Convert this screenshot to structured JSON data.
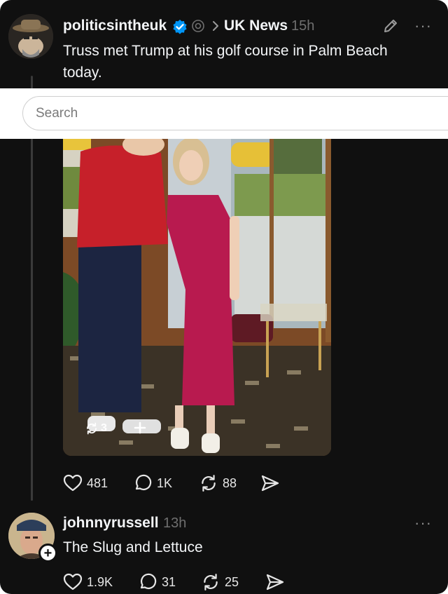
{
  "post": {
    "username": "politicsintheuk",
    "community": "UK News",
    "time": "15h",
    "text_line1": "Truss met Trump at his golf course in Palm Beach",
    "text_line2": "today.",
    "more": "···",
    "image_repost_count": "3",
    "actions": {
      "likes": "481",
      "replies": "1K",
      "reposts": "88"
    }
  },
  "search": {
    "placeholder": "Search"
  },
  "reply": {
    "username": "johnnyrussell",
    "time": "13h",
    "text": "The Slug and Lettuce",
    "follow": "+",
    "more": "···",
    "actions": {
      "likes": "1.9K",
      "replies": "31",
      "reposts": "25"
    }
  },
  "colors": {
    "background": "#101010",
    "verified": "#0095f6",
    "muted": "#6f6f6f"
  },
  "icons": [
    "pencil-icon",
    "verified-badge-icon",
    "threads-icon",
    "chevron-right-icon",
    "heart-icon",
    "comment-icon",
    "repost-icon",
    "share-icon"
  ]
}
